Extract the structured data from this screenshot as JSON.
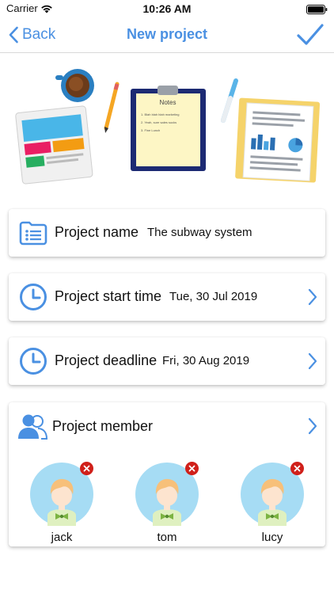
{
  "status_bar": {
    "carrier": "Carrier",
    "time": "10:26 AM"
  },
  "nav": {
    "back_label": "Back",
    "title": "New project"
  },
  "hero": {
    "notes_title": "Notes",
    "note_lines": [
      "1. Blah blah blah marketing",
      "2. Yeah, sure sales sucks",
      "3. Fine Lunch"
    ]
  },
  "fields": {
    "name": {
      "label": "Project name",
      "value": "The subway system"
    },
    "start": {
      "label": "Project start time",
      "value": "Tue, 30 Jul 2019"
    },
    "deadline": {
      "label": "Project deadline",
      "value": "Fri, 30 Aug 2019"
    }
  },
  "members": {
    "label": "Project member",
    "list": [
      {
        "name": "jack"
      },
      {
        "name": "tom"
      },
      {
        "name": "lucy"
      }
    ]
  },
  "colors": {
    "accent": "#4a90e2",
    "remove": "#d0201a",
    "avatar_bg": "#a6dcf4"
  }
}
